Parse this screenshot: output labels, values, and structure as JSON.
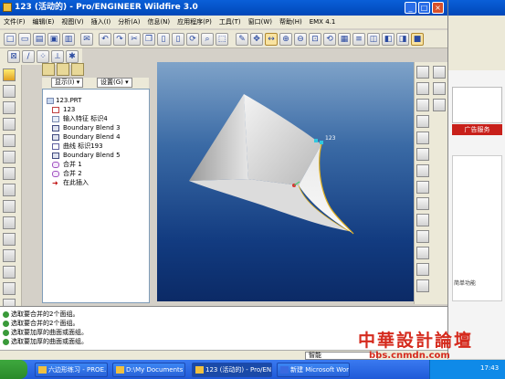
{
  "window": {
    "title": "123 (活动的) - Pro/ENGINEER Wildfire 3.0",
    "buttons": {
      "minimize": "_",
      "maximize": "□",
      "close": "×"
    }
  },
  "menubar": [
    "文件(F)",
    "编辑(E)",
    "视图(V)",
    "插入(I)",
    "分析(A)",
    "信息(N)",
    "应用程序(P)",
    "工具(T)",
    "窗口(W)",
    "帮助(H)",
    "EMX 4.1"
  ],
  "model_tree": {
    "show_label": "显示(I) ▾",
    "settings_label": "设置(G) ▾",
    "items": [
      {
        "label": "123.PRT",
        "icon": "part-icon"
      },
      {
        "label": "123",
        "icon": "datum-icon"
      },
      {
        "label": "输入特征 标识4",
        "icon": "import-feature-icon"
      },
      {
        "label": "Boundary Blend 3",
        "icon": "boundary-blend-icon"
      },
      {
        "label": "Boundary Blend 4",
        "icon": "boundary-blend-icon"
      },
      {
        "label": "曲线 标识193",
        "icon": "curve-icon"
      },
      {
        "label": "Boundary Blend 5",
        "icon": "boundary-blend-icon"
      },
      {
        "label": "合并 1",
        "icon": "merge-icon"
      },
      {
        "label": "合并 2",
        "icon": "merge-icon"
      },
      {
        "label": "在此插入",
        "icon": "insert-here-icon"
      }
    ]
  },
  "graphics": {
    "point_label": "123"
  },
  "messages": [
    "选取要合并的2个面组。",
    "选取要合并的2个面组。",
    "选取要加厚的曲面或面组。",
    "选取要加厚的曲面或面组。"
  ],
  "status": {
    "filter": "智能"
  },
  "watermark": {
    "text": "中華設計論壇",
    "sub": "bbs.cnmdn.com"
  },
  "taskbar": {
    "tasks": [
      "六边形练习 - PROE...",
      "D:\\My Documents",
      "123 (活动的) - Pro/EN...",
      "新建 Microsoft Word ..."
    ],
    "clock": "17:43"
  },
  "background_window": {
    "banner_red": "广告服务",
    "ad_text": "简单功能"
  },
  "colors": {
    "titlebar": "#0a5fd8",
    "canvas_top": "#7fa3c9",
    "canvas_bottom": "#0b2a66",
    "surface_edge": "#e0b020",
    "watermark": "#d52b1e"
  }
}
